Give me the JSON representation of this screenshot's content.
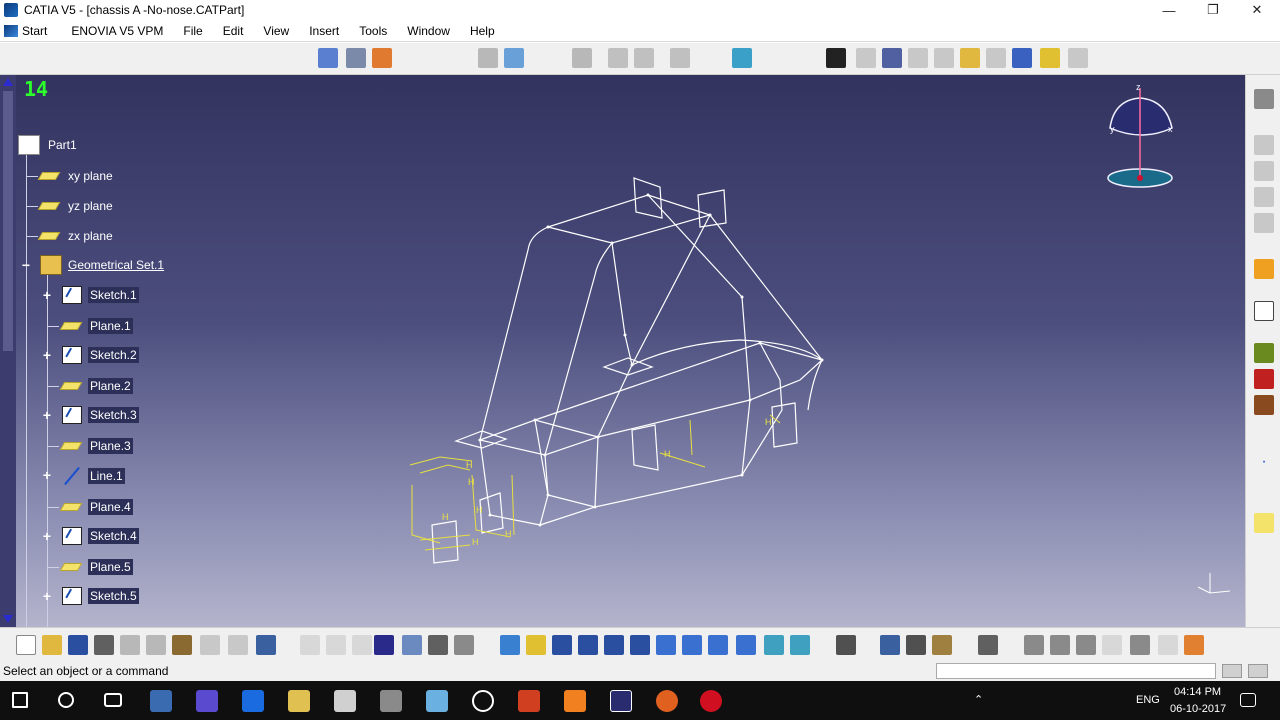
{
  "window": {
    "title": "CATIA V5 - [chassis A -No-nose.CATPart]",
    "controls": {
      "minimize": "—",
      "maximize": "❐",
      "close": "✕"
    },
    "mdi_controls": {
      "minimize": "–",
      "restore": "❐",
      "close": "✕"
    }
  },
  "menubar": {
    "items": [
      "Start",
      "ENOVIA V5 VPM",
      "File",
      "Edit",
      "View",
      "Insert",
      "Tools",
      "Window",
      "Help"
    ]
  },
  "viewport": {
    "frame_counter": "14",
    "compass_axes": {
      "x": "x",
      "y": "y",
      "z": "z"
    }
  },
  "tree": {
    "root": "Part1",
    "items": [
      {
        "label": "xy plane",
        "icon": "plane-icon",
        "selected": false
      },
      {
        "label": "yz plane",
        "icon": "plane-icon",
        "selected": false
      },
      {
        "label": "zx plane",
        "icon": "plane-icon",
        "selected": false
      },
      {
        "label": "Geometrical Set.1",
        "icon": "geometrical-set-icon",
        "selected": false
      },
      {
        "label": "Sketch.1",
        "icon": "sketch-icon",
        "selected": true
      },
      {
        "label": "Plane.1",
        "icon": "plane-icon",
        "selected": true
      },
      {
        "label": "Sketch.2",
        "icon": "sketch-icon",
        "selected": true
      },
      {
        "label": "Plane.2",
        "icon": "plane-icon",
        "selected": true
      },
      {
        "label": "Sketch.3",
        "icon": "sketch-icon",
        "selected": true
      },
      {
        "label": "Plane.3",
        "icon": "plane-icon",
        "selected": true
      },
      {
        "label": "Line.1",
        "icon": "line-icon",
        "selected": true
      },
      {
        "label": "Plane.4",
        "icon": "plane-icon",
        "selected": true
      },
      {
        "label": "Sketch.4",
        "icon": "sketch-icon",
        "selected": true
      },
      {
        "label": "Plane.5",
        "icon": "plane-icon",
        "selected": true
      },
      {
        "label": "Sketch.5",
        "icon": "sketch-icon",
        "selected": true
      }
    ]
  },
  "status": {
    "message": "Select an object or a command"
  },
  "taskbar": {
    "language": "ENG",
    "time": "04:14 PM",
    "date": "06-10-2017"
  },
  "colors": {
    "viewport_top": "#33335f",
    "viewport_bottom": "#b4b4cc",
    "wireframe": "#ffffff",
    "constraint": "#e8e040",
    "counter": "#2cff2c"
  }
}
